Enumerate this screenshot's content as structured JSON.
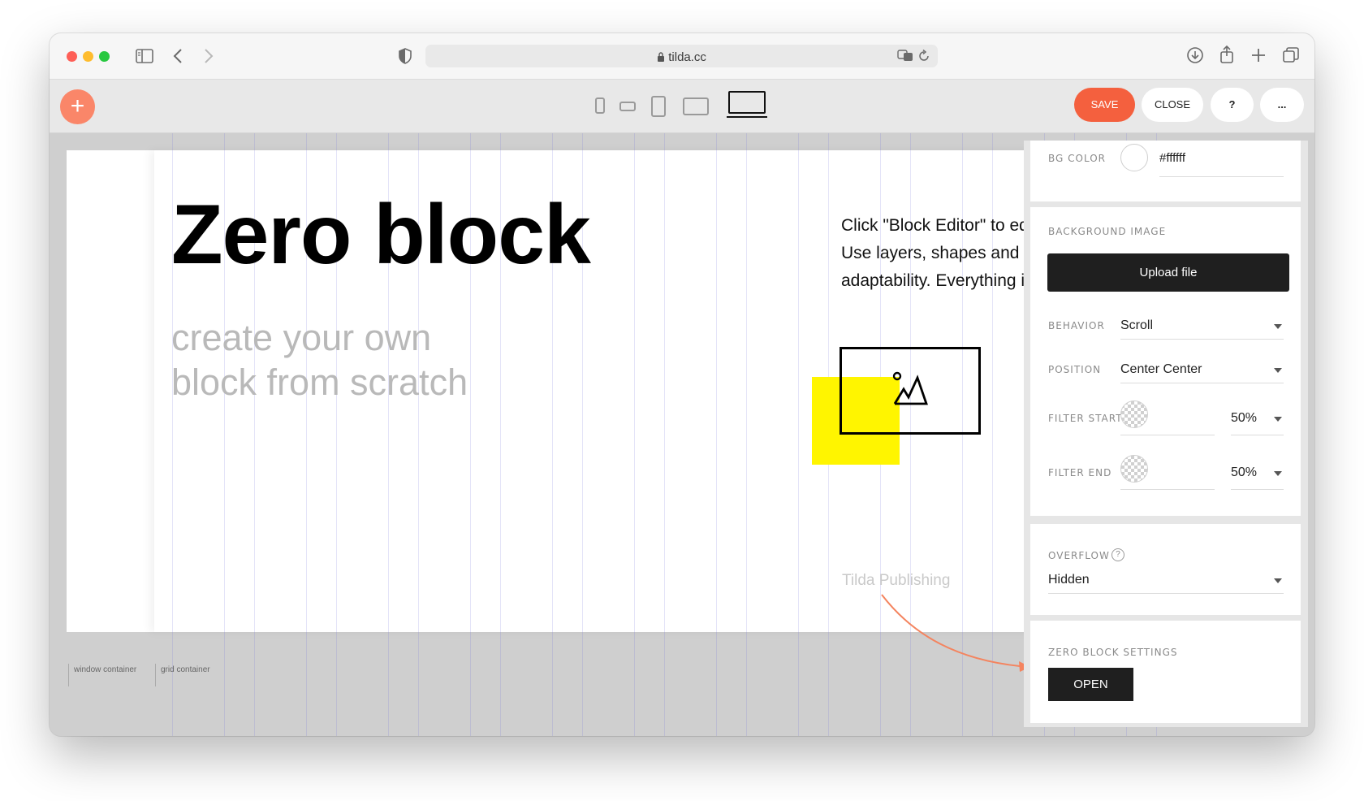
{
  "browser": {
    "url": "tilda.cc",
    "colors": {
      "close": "#fe5f57",
      "minimize": "#febc2e",
      "maximize": "#28c840"
    }
  },
  "editor_toolbar": {
    "add_icon": "+",
    "devices": [
      "phone-portrait",
      "phone-landscape",
      "tablet-portrait",
      "tablet-landscape",
      "desktop"
    ],
    "active_device": "desktop",
    "save_label": "SAVE",
    "close_label": "CLOSE",
    "help_label": "?",
    "more_label": "..."
  },
  "canvas": {
    "title": "Zero block",
    "subtitle_line1": "create your own",
    "subtitle_line2": "block from scratch",
    "description": [
      "Click \"Block Editor\" to edit",
      "Use layers, shapes and",
      "adaptability. Everything is"
    ],
    "image_placeholder_icon": "image-icon",
    "tilda_text": "Tilda Publishing",
    "container_labels": {
      "window": "window container",
      "grid": "grid container"
    },
    "accent_yellow": "#fff500"
  },
  "panel": {
    "bg_color": {
      "label": "BG COLOR",
      "value": "#ffffff"
    },
    "background_image": {
      "label": "BACKGROUND IMAGE",
      "upload_label": "Upload file"
    },
    "behavior": {
      "label": "BEHAVIOR",
      "value": "Scroll"
    },
    "position": {
      "label": "POSITION",
      "value": "Center Center"
    },
    "filter_start": {
      "label": "FILTER START",
      "value": "50%"
    },
    "filter_end": {
      "label": "FILTER END",
      "value": "50%"
    },
    "overflow": {
      "label": "OVERFLOW",
      "value": "Hidden",
      "help": "?"
    },
    "zero_block_settings": {
      "label": "ZERO BLOCK SETTINGS",
      "open_label": "OPEN"
    },
    "annotation_color": "#f4845f"
  }
}
